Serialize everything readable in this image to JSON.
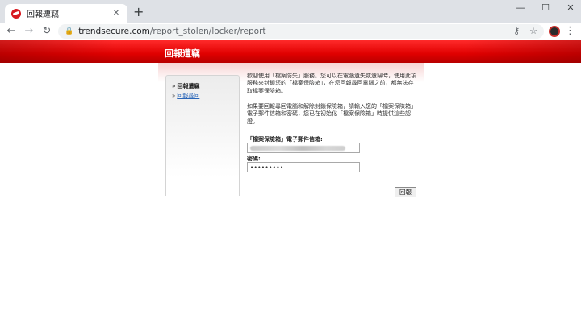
{
  "browser": {
    "tab_title": "回報遭竊",
    "new_tab_icon": "plus-icon",
    "url_host": "trendsecure.com",
    "url_path": "/report_stolen/locker/report"
  },
  "page": {
    "banner_title": "回報遭竊",
    "sidebar": {
      "items": [
        {
          "label": "回報遭竊",
          "active": true
        },
        {
          "label": "回報尋回",
          "active": false
        }
      ]
    },
    "intro_paragraph": "歡迎使用「檔案防失」服務。您可以在電腦遺失或遭竊時，使用此項服務來封鎖您的「檔案保險箱」，在您回報尋回電腦之前，都無法存取檔案保險箱。",
    "instruction_paragraph": "如果要回報尋回電腦和解除封鎖保險箱，請輸入您的「檔案保險箱」電子郵件信箱和密碼，您已在初始化「檔案保險箱」時提供這些認證。",
    "email_label": "「檔案保險箱」電子郵件信箱:",
    "password_label": "密碼:",
    "password_value": "•••••••••",
    "submit_label": "回報"
  },
  "colors": {
    "banner_red": "#e00000",
    "link_blue": "#2a66b8"
  }
}
